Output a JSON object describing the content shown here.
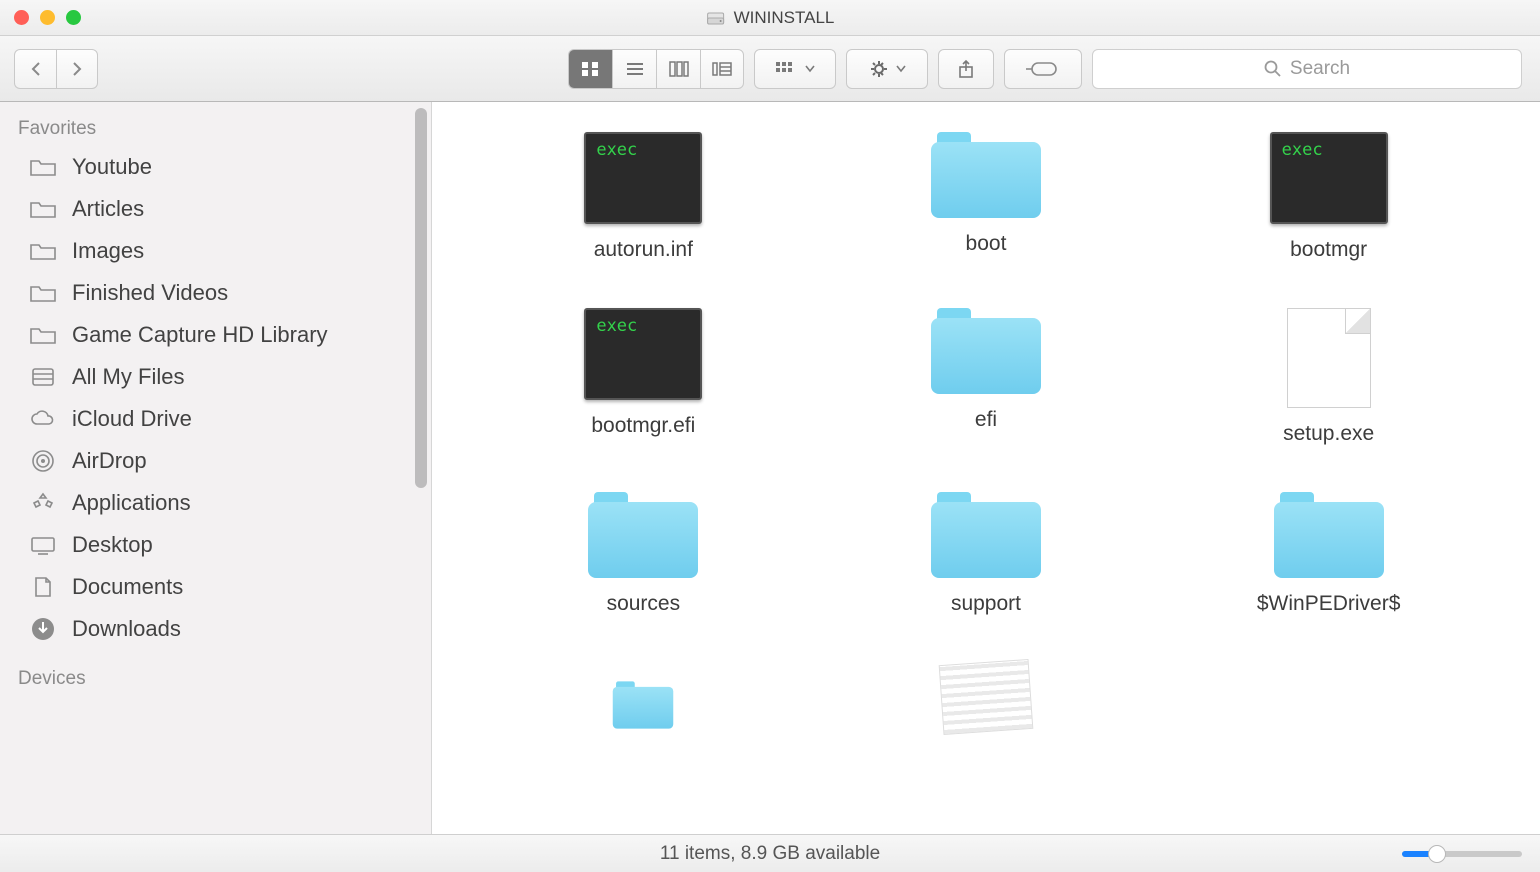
{
  "window": {
    "title": "WININSTALL"
  },
  "search": {
    "placeholder": "Search"
  },
  "sidebar": {
    "sections": [
      {
        "title": "Favorites",
        "items": [
          {
            "icon": "folder",
            "label": "Youtube"
          },
          {
            "icon": "folder",
            "label": "Articles"
          },
          {
            "icon": "folder",
            "label": "Images"
          },
          {
            "icon": "folder",
            "label": "Finished Videos"
          },
          {
            "icon": "folder",
            "label": "Game Capture HD Library"
          },
          {
            "icon": "allfiles",
            "label": "All My Files"
          },
          {
            "icon": "cloud",
            "label": "iCloud Drive"
          },
          {
            "icon": "airdrop",
            "label": "AirDrop"
          },
          {
            "icon": "apps",
            "label": "Applications"
          },
          {
            "icon": "desktop",
            "label": "Desktop"
          },
          {
            "icon": "documents",
            "label": "Documents"
          },
          {
            "icon": "downloads",
            "label": "Downloads"
          }
        ]
      },
      {
        "title": "Devices",
        "items": []
      }
    ]
  },
  "files": [
    {
      "type": "exec",
      "name": "autorun.inf"
    },
    {
      "type": "folder",
      "name": "boot"
    },
    {
      "type": "exec",
      "name": "bootmgr"
    },
    {
      "type": "exec",
      "name": "bootmgr.efi"
    },
    {
      "type": "folder",
      "name": "efi"
    },
    {
      "type": "file",
      "name": "setup.exe"
    },
    {
      "type": "folder",
      "name": "sources"
    },
    {
      "type": "folder",
      "name": "support"
    },
    {
      "type": "folder",
      "name": "$WinPEDriver$"
    },
    {
      "type": "folder",
      "name": ""
    },
    {
      "type": "generic",
      "name": ""
    }
  ],
  "status": {
    "text": "11 items, 8.9 GB available"
  }
}
